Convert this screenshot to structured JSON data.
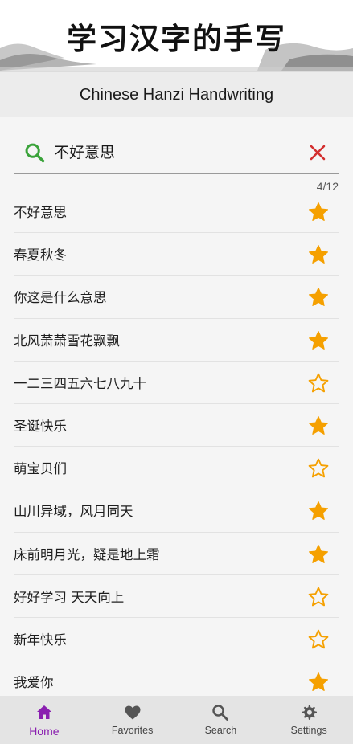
{
  "banner": {
    "title": "学习汉字的手写"
  },
  "subtitle": "Chinese Hanzi Handwriting",
  "search": {
    "value": "不好意思",
    "placeholder": ""
  },
  "counter": "4/12",
  "colors": {
    "accent": "#8a1fb0",
    "star": "#f5a000",
    "search_icon": "#3aa33a",
    "clear_icon": "#d32f2f"
  },
  "items": [
    {
      "label": "不好意思",
      "favorite": true
    },
    {
      "label": "春夏秋冬",
      "favorite": true
    },
    {
      "label": "你这是什么意思",
      "favorite": true
    },
    {
      "label": "北风萧萧雪花飘飘",
      "favorite": true
    },
    {
      "label": "一二三四五六七八九十",
      "favorite": false
    },
    {
      "label": "圣诞快乐",
      "favorite": true
    },
    {
      "label": "萌宝贝们",
      "favorite": false
    },
    {
      "label": "山川异域，风月同天",
      "favorite": true
    },
    {
      "label": "床前明月光，疑是地上霜",
      "favorite": true
    },
    {
      "label": "好好学习 天天向上",
      "favorite": false
    },
    {
      "label": "新年快乐",
      "favorite": false
    },
    {
      "label": "我爱你",
      "favorite": true
    }
  ],
  "nav": [
    {
      "label": "Home",
      "icon": "home-icon",
      "active": true
    },
    {
      "label": "Favorites",
      "icon": "heart-icon",
      "active": false
    },
    {
      "label": "Search",
      "icon": "search-icon",
      "active": false
    },
    {
      "label": "Settings",
      "icon": "gear-icon",
      "active": false
    }
  ]
}
